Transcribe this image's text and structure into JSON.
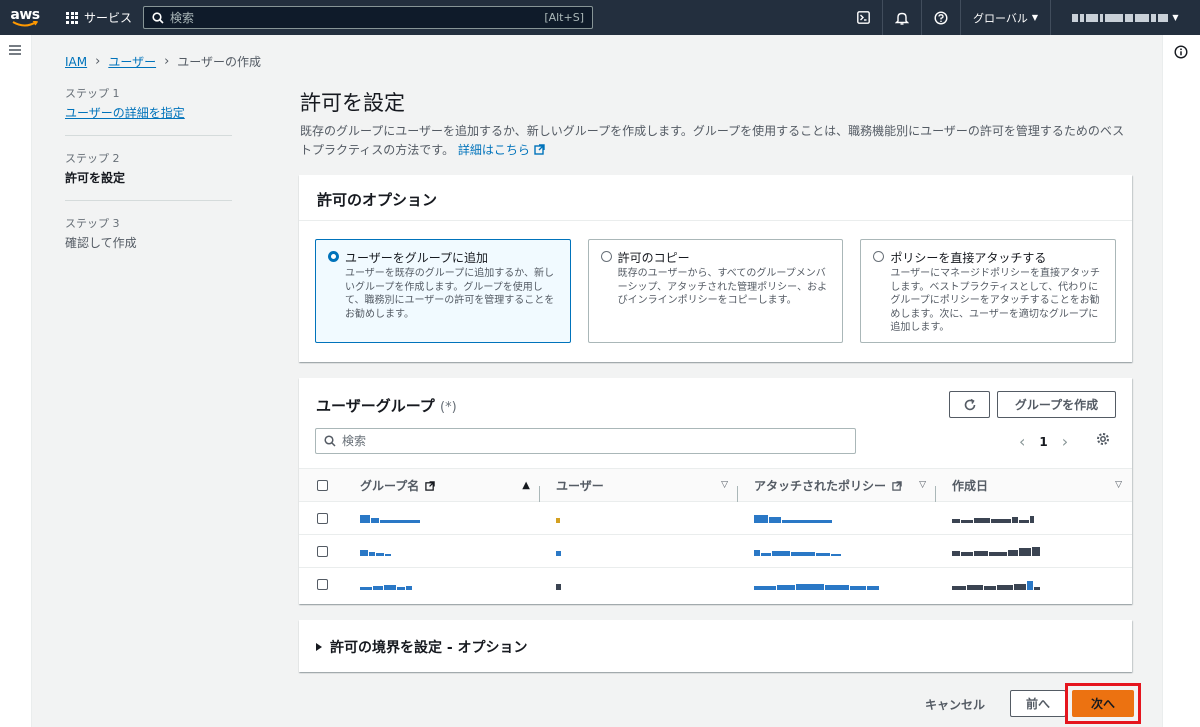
{
  "topnav": {
    "logo_text": "aws",
    "services_label": "サービス",
    "search_placeholder": "検索",
    "search_shortcut": "[Alt+S]",
    "region_label": "グローバル",
    "account_label": "",
    "icons": [
      "cloudshell-icon",
      "bell-icon",
      "help-icon"
    ]
  },
  "breadcrumb": {
    "items": [
      "IAM",
      "ユーザー"
    ],
    "current": "ユーザーの作成"
  },
  "steps": [
    {
      "num": "ステップ 1",
      "label": "ユーザーの詳細を指定",
      "state": "link"
    },
    {
      "num": "ステップ 2",
      "label": "許可を設定",
      "state": "active"
    },
    {
      "num": "ステップ 3",
      "label": "確認して作成",
      "state": "disabled"
    }
  ],
  "page": {
    "title": "許可を設定",
    "description": "既存のグループにユーザーを追加するか、新しいグループを作成します。グループを使用することは、職務機能別にユーザーの許可を管理するためのベストプラクティスの方法です。",
    "learn_more": "詳細はこちら"
  },
  "options": {
    "title": "許可のオプション",
    "cards": [
      {
        "title": "ユーザーをグループに追加",
        "desc": "ユーザーを既存のグループに追加するか、新しいグループを作成します。グループを使用して、職務別にユーザーの許可を管理することをお勧めします。",
        "selected": true
      },
      {
        "title": "許可のコピー",
        "desc": "既存のユーザーから、すべてのグループメンバーシップ、アタッチされた管理ポリシー、およびインラインポリシーをコピーします。",
        "selected": false
      },
      {
        "title": "ポリシーを直接アタッチする",
        "desc": "ユーザーにマネージドポリシーを直接アタッチします。ベストプラクティスとして、代わりにグループにポリシーをアタッチすることをお勧めします。次に、ユーザーを適切なグループに追加します。",
        "selected": false
      }
    ]
  },
  "groups": {
    "title": "ユーザーグループ",
    "count": "(*)",
    "create_label": "グループを作成",
    "search_placeholder": "検索",
    "page_number": "1",
    "columns": [
      "グループ名",
      "ユーザー",
      "アタッチされたポリシー",
      "作成日"
    ]
  },
  "boundary": {
    "title": "許可の境界を設定 - オプション"
  },
  "footer": {
    "cancel": "キャンセル",
    "prev": "前へ",
    "next": "次へ"
  },
  "colors": {
    "nav_bg": "#232f3e",
    "link": "#0073bb",
    "primary": "#ec7211",
    "highlight": "#e5151e"
  }
}
